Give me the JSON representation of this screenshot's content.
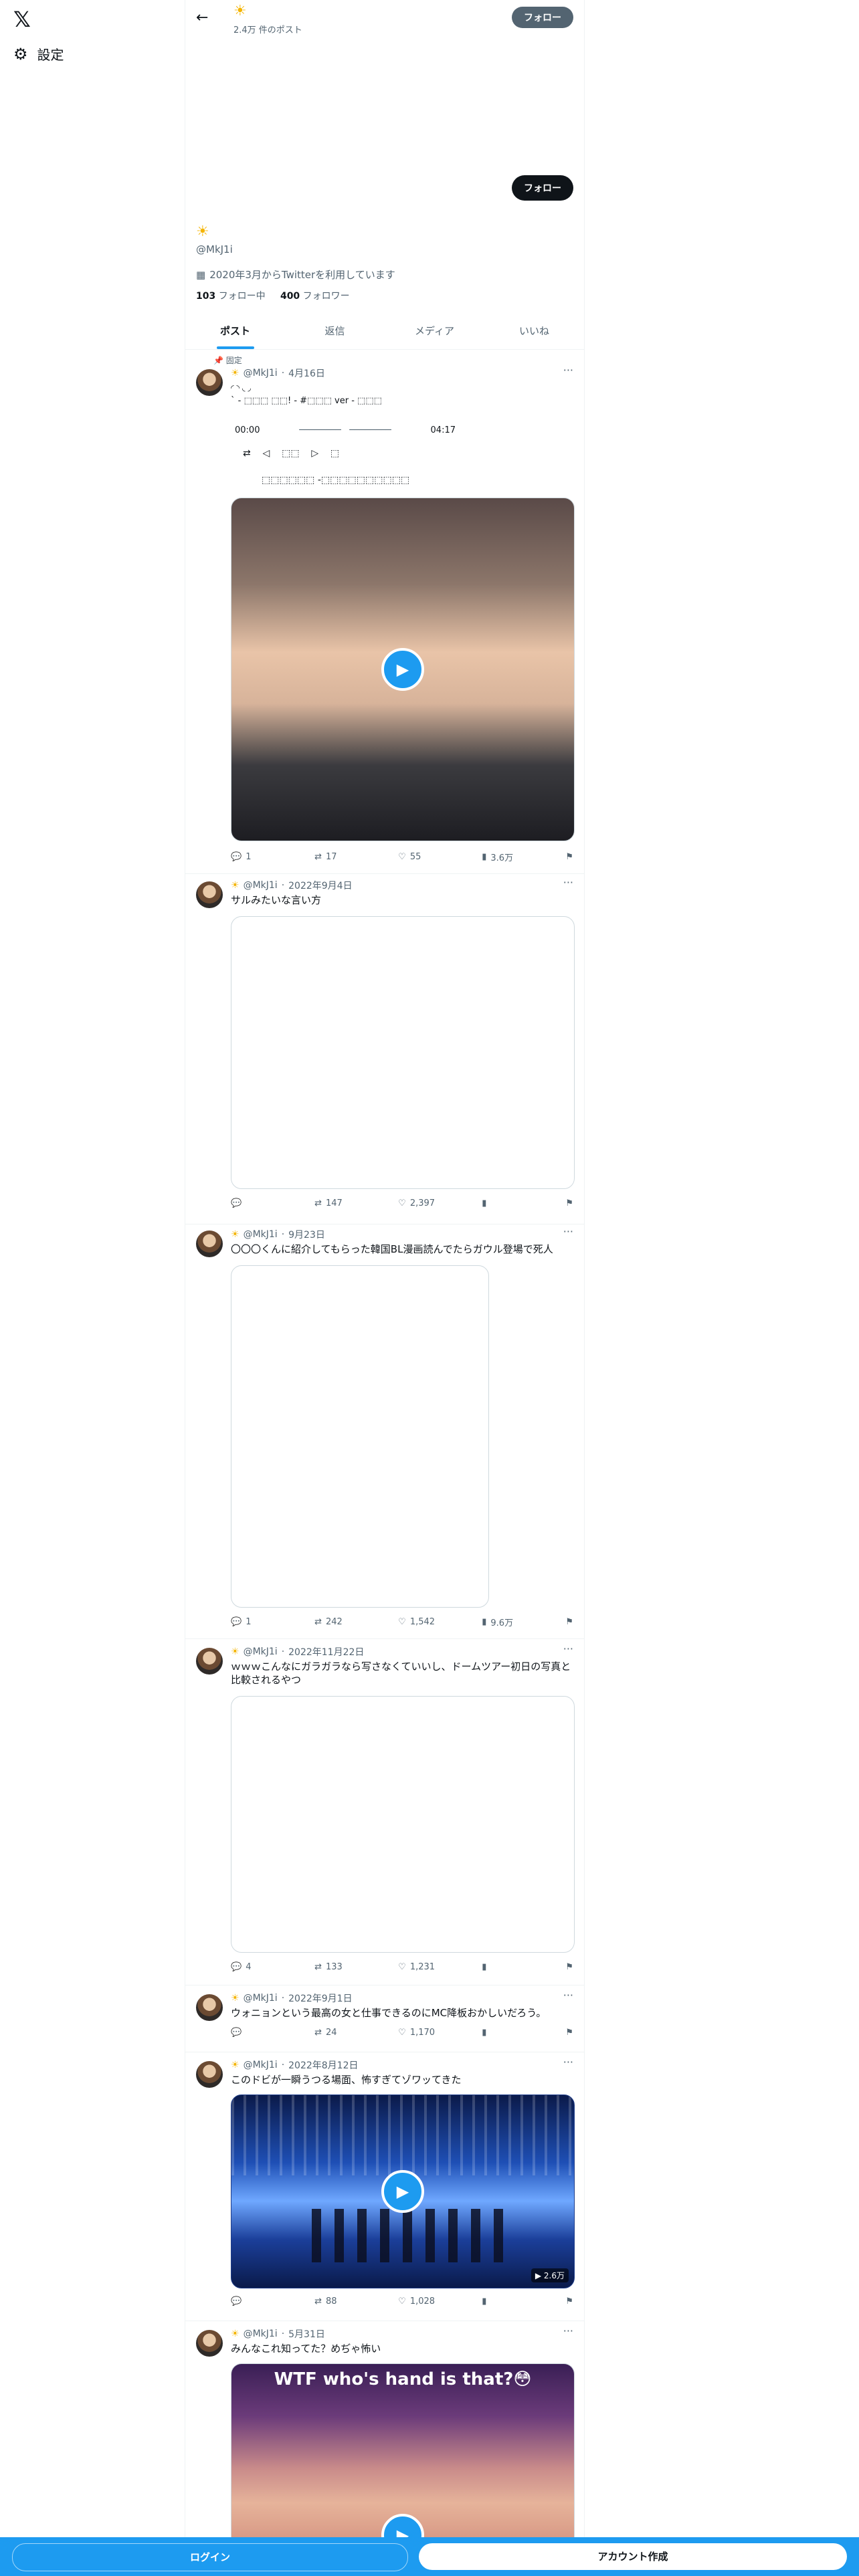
{
  "nav": {
    "settings_label": "設定"
  },
  "header": {
    "count": "2.4万 件のポスト",
    "follow_label": "フォロー"
  },
  "profile": {
    "handle": "@MkJ1i",
    "joined": "2020年3月からTwitterを利用しています",
    "following_count": "103",
    "following_label": "フォロー中",
    "followers_count": "400",
    "followers_label": "フォロワー",
    "follow_label": "フォロー"
  },
  "tabs": [
    "ポスト",
    "返信",
    "メディア",
    "いいね"
  ],
  "pinned_label": "固定",
  "tweets": [
    {
      "handle": "@MkJ1i",
      "date": "4月16日",
      "text1": "◜ ◝ ◟ ◞",
      "text2": "` - ⬚⬚⬚ ⬚⬚! - #⬚⬚⬚ ver - ⬚⬚⬚",
      "time_start": "00:00",
      "time_end": "04:17",
      "controls": "⇄    ◁    ⬚⬚    ▷    ⬚",
      "sub": "⬚⬚⬚⬚⬚⬚ -⬚⬚⬚⬚⬚⬚⬚⬚⬚⬚",
      "replies": "1",
      "retweets": "17",
      "likes": "55",
      "views": "3.6万"
    },
    {
      "handle": "@MkJ1i",
      "date": "2022年9月4日",
      "text": "サルみたいな言い方",
      "replies": "",
      "retweets": "147",
      "likes": "2,397",
      "views": ""
    },
    {
      "handle": "@MkJ1i",
      "date": "9月23日",
      "text": "〇〇〇くんに紹介してもらった韓国BL漫画読んでたらガウル登場で死人",
      "replies": "1",
      "retweets": "242",
      "likes": "1,542",
      "views": "9.6万"
    },
    {
      "handle": "@MkJ1i",
      "date": "2022年11月22日",
      "text": "ｗｗｗこんなにガラガラなら写さなくていいし、ドームツアー初日の写真と比較されるやつ",
      "replies": "4",
      "retweets": "133",
      "likes": "1,231",
      "views": ""
    },
    {
      "handle": "@MkJ1i",
      "date": "2022年9月1日",
      "text": "ウォニョンという最高の女と仕事できるのにMC降板おかしいだろう。",
      "replies": "",
      "retweets": "24",
      "likes": "1,170",
      "views": ""
    },
    {
      "handle": "@MkJ1i",
      "date": "2022年8月12日",
      "text": "このドビが一瞬うつる場面、怖すぎてゾワッてきた",
      "replies": "",
      "retweets": "88",
      "likes": "1,028",
      "views": "",
      "video_views": "2.6万"
    },
    {
      "handle": "@MkJ1i",
      "date": "5月31日",
      "text": "みんなこれ知ってた？めぢゃ怖い",
      "caption": "WTF who's hand is that?😳"
    }
  ],
  "bottom": {
    "login": "ログイン",
    "signup": "アカウント作成"
  }
}
